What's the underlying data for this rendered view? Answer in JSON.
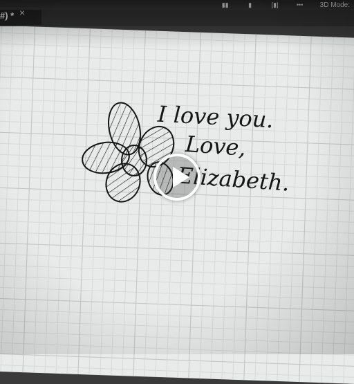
{
  "document_tab": {
    "title": "#) *",
    "close_glyph": "×"
  },
  "toolbar": {
    "mode_label": "3D Mode:",
    "icons": [
      "align-icon",
      "distribute-icon",
      "spacing-icon",
      "more-icon"
    ]
  },
  "canvas": {
    "handwriting": {
      "line1": "I love you.",
      "line2": "Love,",
      "line3": "Elizabeth."
    }
  },
  "video_overlay": {
    "play_icon": "play-icon"
  }
}
